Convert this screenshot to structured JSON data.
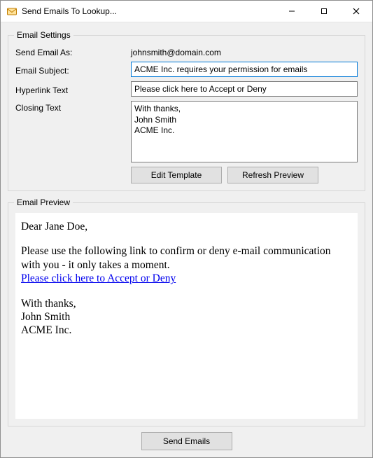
{
  "window": {
    "title": "Send Emails To Lookup..."
  },
  "settings": {
    "legend": "Email Settings",
    "send_as_label": "Send Email As:",
    "send_as_value": "johnsmith@domain.com",
    "subject_label": "Email Subject:",
    "subject_value": "ACME Inc. requires your permission for emails",
    "hyperlink_label": "Hyperlink Text",
    "hyperlink_value": "Please click here to Accept or Deny",
    "closing_label": "Closing Text",
    "closing_value": "With thanks,\nJohn Smith\nACME Inc."
  },
  "buttons": {
    "edit_template": "Edit Template",
    "refresh_preview": "Refresh Preview",
    "send_emails": "Send Emails"
  },
  "preview": {
    "legend": "Email Preview",
    "greeting": "Dear Jane Doe,",
    "body_text": "Please use the following link to confirm or deny e-mail communication with you - it only takes a moment.",
    "link_text": "Please click here to Accept or Deny",
    "closing_lines": [
      "With thanks,",
      "John Smith",
      "ACME Inc."
    ]
  }
}
